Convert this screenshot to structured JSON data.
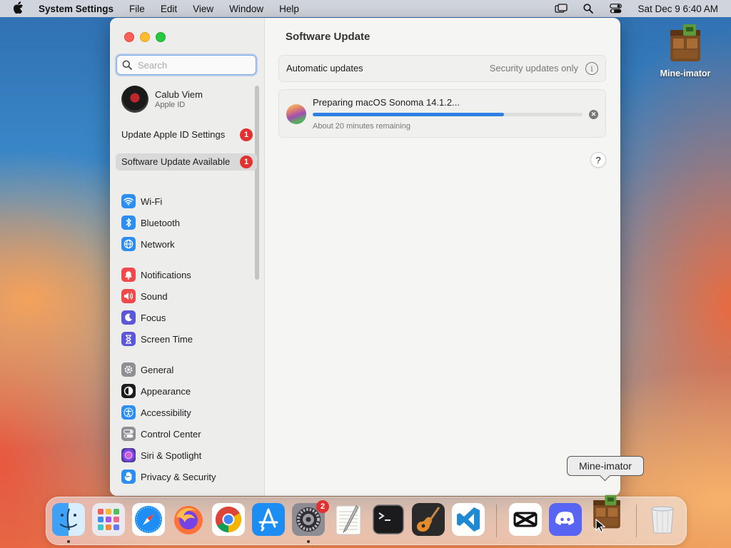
{
  "menubar": {
    "app_name": "System Settings",
    "menus": [
      "File",
      "Edit",
      "View",
      "Window",
      "Help"
    ],
    "clock": "Sat Dec 9  6:40 AM"
  },
  "desktop": {
    "icon_label": "Mine-imator"
  },
  "search": {
    "placeholder": "Search"
  },
  "account": {
    "name": "Calub Viem",
    "subtitle": "Apple ID"
  },
  "alerts": [
    {
      "label": "Update Apple ID Settings",
      "badge": "1"
    },
    {
      "label": "Software Update Available",
      "badge": "1"
    }
  ],
  "sidebar": {
    "network_group": [
      {
        "label": "Wi-Fi",
        "icon": "wifi-icon",
        "color": "#2b8ef0"
      },
      {
        "label": "Bluetooth",
        "icon": "bluetooth-icon",
        "color": "#2b8ef0"
      },
      {
        "label": "Network",
        "icon": "globe-icon",
        "color": "#2b8ef0"
      }
    ],
    "notify_group": [
      {
        "label": "Notifications",
        "icon": "bell-icon",
        "color": "#f0494b"
      },
      {
        "label": "Sound",
        "icon": "speaker-icon",
        "color": "#f0494b"
      },
      {
        "label": "Focus",
        "icon": "moon-icon",
        "color": "#5b57d8"
      },
      {
        "label": "Screen Time",
        "icon": "hourglass-icon",
        "color": "#5b57d8"
      }
    ],
    "system_group": [
      {
        "label": "General",
        "icon": "gear-icon",
        "color": "#8e8e93"
      },
      {
        "label": "Appearance",
        "icon": "appearance-icon",
        "color": "#1c1c1e"
      },
      {
        "label": "Accessibility",
        "icon": "accessibility-icon",
        "color": "#2b8ef0"
      },
      {
        "label": "Control Center",
        "icon": "control-center-icon",
        "color": "#8e8e93"
      },
      {
        "label": "Siri & Spotlight",
        "icon": "siri-icon",
        "color": "#c93fd6"
      },
      {
        "label": "Privacy & Security",
        "icon": "hand-icon",
        "color": "#2b8ef0"
      }
    ]
  },
  "content": {
    "title": "Software Update",
    "automatic_updates": {
      "label": "Automatic updates",
      "value": "Security updates only"
    },
    "update": {
      "title": "Preparing macOS Sonoma 14.1.2...",
      "progress": 0.71,
      "remaining": "About 20 minutes remaining"
    },
    "help": "?"
  },
  "tooltip": "Mine-imator",
  "dock": {
    "apps": [
      {
        "name": "Finder",
        "icon": "finder-icon",
        "running": true
      },
      {
        "name": "Launchpad",
        "icon": "launchpad-icon",
        "running": false
      },
      {
        "name": "Safari",
        "icon": "safari-icon",
        "running": false
      },
      {
        "name": "Firefox",
        "icon": "firefox-icon",
        "running": false
      },
      {
        "name": "Chrome",
        "icon": "chrome-icon",
        "running": false
      },
      {
        "name": "App Store",
        "icon": "app-store-icon",
        "running": false
      },
      {
        "name": "System Settings",
        "icon": "system-settings-icon",
        "running": true,
        "badge": "2"
      },
      {
        "name": "TextEdit",
        "icon": "textedit-icon",
        "running": false
      },
      {
        "name": "Terminal",
        "icon": "terminal-icon",
        "running": false
      },
      {
        "name": "GarageBand",
        "icon": "garageband-icon",
        "running": false
      },
      {
        "name": "VS Code",
        "icon": "vscode-icon",
        "running": false
      },
      {
        "name": "CapCut",
        "icon": "capcut-icon",
        "running": false
      },
      {
        "name": "Discord",
        "icon": "discord-icon",
        "running": false
      },
      {
        "name": "Mine-imator",
        "icon": "mine-imator-icon",
        "running": false
      },
      {
        "name": "Trash",
        "icon": "trash-icon",
        "running": false
      }
    ]
  }
}
